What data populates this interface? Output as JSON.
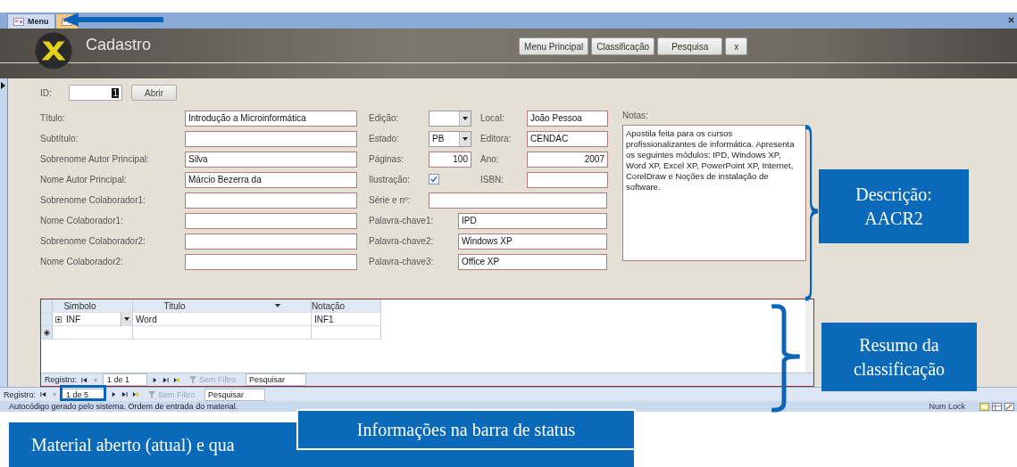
{
  "tabs": [
    {
      "label": "Menu",
      "selected": false
    },
    {
      "selected": true
    }
  ],
  "header": {
    "title": "Cadastro",
    "buttons": [
      "Menu Principal",
      "Classificação",
      "Pesquisa",
      "x"
    ]
  },
  "id_field": {
    "label": "ID:",
    "value": "1",
    "button": "Abrir"
  },
  "left_fields": [
    {
      "label": "Título:",
      "value": "Introdução a Microinformática"
    },
    {
      "label": "Subtítulo:"
    },
    {
      "label": "Sobrenome Autor Principal:",
      "value": "Silva"
    },
    {
      "label": "Nome Autor Principal:",
      "value": "Márcio Bezerra da"
    },
    {
      "label": "Sobrenome Colaborador1:"
    },
    {
      "label": "Nome Colaborador1:"
    },
    {
      "label": "Sobrenome Colaborador2:"
    },
    {
      "label": "Nome Colaborador2:"
    }
  ],
  "middle_rows": [
    [
      {
        "label": "Edição:",
        "kind": "combo"
      },
      {
        "label": "Local:",
        "kind": "text",
        "value": "João Pessoa"
      }
    ],
    [
      {
        "label": "Estado:",
        "kind": "combo",
        "value": "PB"
      },
      {
        "label": "Editora:",
        "kind": "text",
        "value": "CENDAC"
      }
    ],
    [
      {
        "label": "Páginas:",
        "kind": "number",
        "value": "100"
      },
      {
        "label": "Ano:",
        "kind": "number",
        "value": "2007"
      }
    ],
    [
      {
        "label": "Ilustração:",
        "kind": "check",
        "checked": true
      },
      {
        "label": "ISBN:",
        "kind": "text"
      }
    ],
    [
      {
        "label": "Série e nº:",
        "kind": "wide"
      }
    ],
    [
      {
        "label": "Palavra-chave1:",
        "kind": "keyword",
        "value": "IPD"
      }
    ],
    [
      {
        "label": "Palavra-chave2:",
        "kind": "keyword",
        "value": "Windows XP"
      }
    ],
    [
      {
        "label": "Palavra-chave3:",
        "kind": "keyword",
        "value": "Office XP"
      }
    ]
  ],
  "notes": {
    "label": "Notas:",
    "text": "Apostila feita para os cursos profissionalizantes de informática. Apresenta os seguintes módulos: IPD, Windows XP, Word XP, Excel XP, PowerPoint XP, Internet, CorelDraw e Noções de instalação de software."
  },
  "subform": {
    "columns": [
      "Simbolo",
      "Titulo",
      "Notação"
    ],
    "rows": [
      {
        "cells": [
          "INF",
          "Word",
          "INF1"
        ]
      }
    ],
    "navigator": {
      "label": "Registro:",
      "position": "1 de 1",
      "filter": "Sem Filtro",
      "search": {
        "placeholder": "Pesquisar"
      }
    }
  },
  "navigator": {
    "label": "Registro:",
    "position": "1 de 5",
    "filter": "Sem Filtro",
    "search": {
      "placeholder": "Pesquisar"
    }
  },
  "status_bar": {
    "text": "Autocódigo gerado pelo sistema. Ordem de entrada do material.",
    "indicator": "Num Lock"
  },
  "callouts": [
    {
      "text": "Descrição: AACR2"
    },
    {
      "text": "Resumo da classificação"
    },
    {
      "text": "Material aberto (atual) e qua"
    },
    {
      "text": "Informações na barra de status"
    }
  ]
}
